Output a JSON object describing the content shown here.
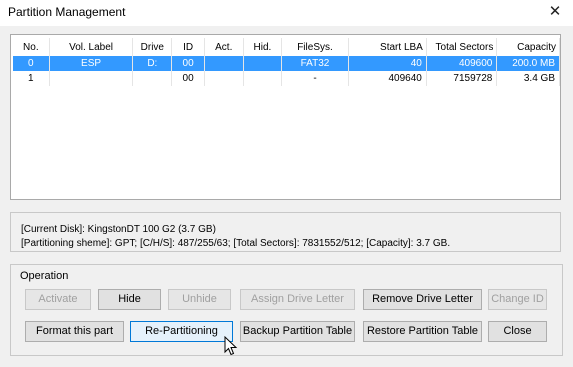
{
  "window": {
    "title": "Partition Management",
    "close_glyph": "✕"
  },
  "partition_table": {
    "columns": [
      "No.",
      "Vol. Label",
      "Drive",
      "ID",
      "Act.",
      "Hid.",
      "FileSys.",
      "Start LBA",
      "Total Sectors",
      "Capacity"
    ],
    "rows": [
      {
        "no": "0",
        "label": "ESP",
        "drive": "D:",
        "id": "00",
        "act": "",
        "hid": "",
        "fs": "FAT32",
        "start": "40",
        "sectors": "409600",
        "capacity": "200.0 MB",
        "selected": true
      },
      {
        "no": "1",
        "label": "",
        "drive": "",
        "id": "00",
        "act": "",
        "hid": "",
        "fs": "-",
        "start": "409640",
        "sectors": "7159728",
        "capacity": "3.4 GB",
        "selected": false
      }
    ]
  },
  "disk_info": {
    "current_disk": "[Current Disk]:   KingstonDT 100 G2 (3.7 GB)",
    "partitioning": "[Partitioning sheme]:    GPT;     [C/H/S]: 487/255/63; [Total Sectors]: 7831552/512; [Capacity]: 3.7 GB."
  },
  "operation": {
    "label": "Operation",
    "buttons": {
      "activate": "Activate",
      "hide": "Hide",
      "unhide": "Unhide",
      "assign": "Assign Drive Letter",
      "remove": "Remove Drive Letter",
      "change_id": "Change ID",
      "format": "Format this part",
      "repartition": "Re-Partitioning",
      "backup": "Backup Partition Table",
      "restore": "Restore Partition Table",
      "close": "Close"
    }
  },
  "icons": {
    "close": "close-icon",
    "cursor": "mouse-cursor-icon"
  },
  "colors": {
    "selection": "#3399ff",
    "hover_border": "#0078d7"
  }
}
